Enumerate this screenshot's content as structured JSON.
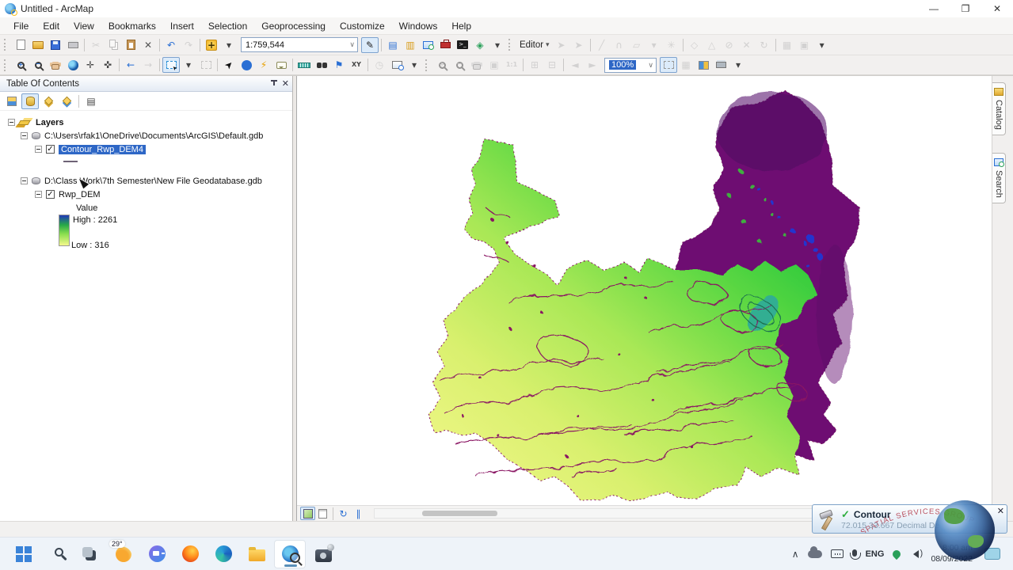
{
  "window": {
    "title": "Untitled - ArcMap",
    "minimize": "—",
    "restore": "❐",
    "close": "✕"
  },
  "menu": {
    "items": [
      "File",
      "Edit",
      "View",
      "Bookmarks",
      "Insert",
      "Selection",
      "Geoprocessing",
      "Customize",
      "Windows",
      "Help"
    ]
  },
  "glyphs": {
    "cut": "✂",
    "delete": "✕",
    "undo": "↶",
    "redo": "↷",
    "dd": "▾",
    "edit": "✎",
    "wtoc": "▤",
    "wcat": "▥",
    "model": "◈",
    "earrow": "➤",
    "eline": "╱",
    "earc": "∩",
    "epoly": "▱",
    "epoint": "✳",
    "evert": "◇",
    "ereshape": "△",
    "esplit": "⊘",
    "erotate": "↻",
    "eattr": "▦",
    "esketch": "▣",
    "fzi": "✛",
    "fzo": "✜",
    "back": "←",
    "fwd": "→",
    "selel": "➤",
    "bolt": "⚡",
    "flag": "⚑",
    "xy": "XY",
    "clock": "◷",
    "pgzi": "⊞",
    "pgzo": "⊟",
    "pg11": "1:1",
    "pgfull": "▣",
    "pggrid": "▦",
    "pgcrop": "◱",
    "pgl": "◄",
    "pgr": "►",
    "adddata": "+",
    "python": "&gt;_",
    "opt": "▤",
    "refresh": "↻",
    "pause": "∥"
  },
  "toolbar_main": {
    "scale_value": "1:759,544",
    "items": [
      {
        "n": "new-document-button",
        "g": "page"
      },
      {
        "n": "open-button",
        "g": "foldero"
      },
      {
        "n": "save-button",
        "g": "save"
      },
      {
        "n": "print-button",
        "g": "print"
      },
      {
        "sep": true
      },
      {
        "n": "cut-button",
        "g": "cut",
        "d": 1
      },
      {
        "n": "copy-button",
        "g": "copy",
        "d": 1
      },
      {
        "n": "paste-button",
        "g": "paste"
      },
      {
        "n": "delete-button",
        "g": "delete",
        "c": "#555"
      },
      {
        "sep": true
      },
      {
        "n": "undo-button",
        "g": "undo",
        "c": "#2a6fd4"
      },
      {
        "n": "redo-button",
        "g": "redo",
        "d": 1
      },
      {
        "sep": true
      },
      {
        "n": "add-data-button",
        "g": "adddata"
      },
      {
        "n": "add-data-dropdown",
        "g": "dd",
        "c": "#444"
      }
    ],
    "items2": [
      {
        "n": "edit-vertices-button",
        "g": "edit",
        "x": 1,
        "c": "#222"
      },
      {
        "sep": true
      },
      {
        "n": "table-of-contents-window-button",
        "g": "wtoc",
        "c": "#2a6fd4"
      },
      {
        "n": "catalog-window-button",
        "g": "wcat",
        "c": "#d89b18"
      },
      {
        "n": "search-window-button",
        "g": "wsearch"
      },
      {
        "n": "arctoolbox-window-button",
        "g": "toolbox"
      },
      {
        "n": "python-window-button",
        "g": "python"
      },
      {
        "n": "modelbuilder-button",
        "g": "model",
        "c": "#2aa05a"
      },
      {
        "n": "standard-toolbar-overflow",
        "g": "dd",
        "c": "#444"
      }
    ]
  },
  "toolbar_editor": {
    "label": "Editor",
    "items": [
      {
        "n": "editor-edit-tool",
        "g": "earrow",
        "d": 1
      },
      {
        "n": "editor-annotation-tool",
        "g": "earrow",
        "d": 1
      },
      {
        "sep": true
      },
      {
        "n": "straight-segment-tool",
        "g": "eline",
        "d": 1
      },
      {
        "n": "endpoint-arc-tool",
        "g": "earc",
        "d": 1
      },
      {
        "n": "construction-tool",
        "g": "epoly",
        "d": 1
      },
      {
        "n": "construction-dropdown",
        "g": "dd",
        "d": 1
      },
      {
        "n": "point-tool",
        "g": "epoint",
        "d": 1
      },
      {
        "sep": true
      },
      {
        "n": "edit-vertices-tool",
        "g": "evert",
        "d": 1
      },
      {
        "n": "reshape-feature-tool",
        "g": "ereshape",
        "d": 1
      },
      {
        "n": "cut-polygons-tool",
        "g": "esplit",
        "d": 1
      },
      {
        "n": "split-tool",
        "g": "delete",
        "d": 1
      },
      {
        "n": "rotate-tool",
        "g": "erotate",
        "d": 1
      },
      {
        "sep": true
      },
      {
        "n": "attributes-button",
        "g": "eattr",
        "d": 1
      },
      {
        "n": "sketch-properties-button",
        "g": "esketch",
        "d": 1
      },
      {
        "n": "editor-toolbar-overflow",
        "g": "dd",
        "c": "#444"
      }
    ]
  },
  "toolbar_tools": {
    "items": [
      {
        "n": "zoom-in-button",
        "g": "magp"
      },
      {
        "n": "zoom-out-button",
        "g": "magm"
      },
      {
        "n": "pan-button",
        "g": "hand"
      },
      {
        "n": "full-extent-button",
        "g": "globe"
      },
      {
        "n": "fixed-zoom-in-button",
        "g": "fzi",
        "c": "#444"
      },
      {
        "n": "fixed-zoom-out-button",
        "g": "fzo",
        "c": "#444"
      },
      {
        "sep": true
      },
      {
        "n": "go-back-extent-button",
        "g": "back",
        "c": "#2a6fd4"
      },
      {
        "n": "go-forward-extent-button",
        "g": "fwd",
        "d": 1
      },
      {
        "sep": true
      },
      {
        "n": "select-features-button",
        "g": "selfeat",
        "x": 1
      },
      {
        "n": "select-features-dropdown",
        "g": "dd",
        "c": "#444"
      },
      {
        "n": "clear-selected-features-button",
        "g": "clearsel",
        "d": 1
      },
      {
        "sep": true
      },
      {
        "n": "select-elements-button",
        "g": "selel",
        "c": "#111",
        "rot": 1
      },
      {
        "n": "identify-button",
        "g": "ident"
      },
      {
        "n": "hyperlink-button",
        "g": "bolt",
        "c": "#e8a000"
      },
      {
        "n": "html-popup-button",
        "g": "bubble"
      },
      {
        "sep": true
      },
      {
        "n": "measure-button",
        "g": "ruler"
      },
      {
        "n": "find-button",
        "g": "binoc"
      },
      {
        "n": "find-route-button",
        "g": "flag",
        "c": "#2a6fd4"
      },
      {
        "n": "go-to-xy-button",
        "g": "xy",
        "c": "#444"
      },
      {
        "sep": true
      },
      {
        "n": "time-slider-button",
        "g": "clock",
        "d": 1
      },
      {
        "n": "create-viewer-window-button",
        "g": "viewer"
      },
      {
        "n": "tools-toolbar-overflow",
        "g": "dd",
        "c": "#444"
      }
    ]
  },
  "toolbar_layout": {
    "zoom_value": "100%",
    "items": [
      {
        "n": "zoom-in-layout-button",
        "g": "magp",
        "d": 1
      },
      {
        "n": "zoom-out-layout-button",
        "g": "magm",
        "d": 1
      },
      {
        "n": "pan-layout-button",
        "g": "hand",
        "d": 1
      },
      {
        "n": "zoom-whole-page-button",
        "g": "pgfull",
        "d": 1
      },
      {
        "n": "zoom-100-button",
        "g": "pg11",
        "d": 1
      },
      {
        "sep": true
      },
      {
        "n": "fixed-zoom-in-layout-button",
        "g": "pgzi",
        "d": 1
      },
      {
        "n": "fixed-zoom-out-layout-button",
        "g": "pgzo",
        "d": 1
      },
      {
        "sep": true
      },
      {
        "n": "previous-page-button",
        "g": "pgl",
        "d": 1
      },
      {
        "n": "next-page-button",
        "g": "pgr",
        "d": 1
      }
    ],
    "items2": [
      {
        "n": "toggle-draft-mode-button",
        "g": "clearsel",
        "x": 1
      },
      {
        "n": "focus-data-frame-button",
        "g": "pggrid",
        "d": 1
      },
      {
        "n": "data-driven-pages-button",
        "g": "ddp"
      },
      {
        "n": "data-driven-page-text-button",
        "g": "ddprint"
      },
      {
        "n": "layout-toolbar-overflow",
        "g": "dd",
        "c": "#444"
      }
    ]
  },
  "toc": {
    "title": "Table Of Contents",
    "buttons": [
      {
        "n": "list-by-drawing-order-button",
        "g": "lod"
      },
      {
        "n": "list-by-source-button",
        "g": "los",
        "x": 1
      },
      {
        "n": "list-by-visibility-button",
        "g": "lov"
      },
      {
        "n": "list-by-selection-button",
        "g": "losel"
      },
      {
        "sep": true
      },
      {
        "n": "toc-options-button",
        "g": "opt",
        "c": "#444"
      }
    ],
    "layers_root": "Layers",
    "gdb1": "C:\\Users\\rfak1\\OneDrive\\Documents\\ArcGIS\\Default.gdb",
    "layer1": "Contour_Rwp_DEM4",
    "gdb2": "D:\\Class Work\\7th Semester\\New File Geodatabase.gdb",
    "layer2": "Rwp_DEM",
    "legend": {
      "field": "Value",
      "high": "High : 2261",
      "low": "Low : 316"
    },
    "checkmark": "✓"
  },
  "dock": {
    "tabs": [
      "Catalog",
      "Search"
    ]
  },
  "view_controls": {
    "items": [
      {
        "n": "data-view-button",
        "g": "dv",
        "x": 1
      },
      {
        "n": "layout-view-button",
        "g": "lv"
      },
      {
        "sep": true
      },
      {
        "n": "refresh-view-button",
        "g": "refresh",
        "c": "#2a6fd4"
      },
      {
        "n": "pause-drawing-button",
        "g": "pause",
        "c": "#2a6fd4"
      }
    ]
  },
  "map": {
    "legend_colors": {
      "high": "#2038b8",
      "mid": "#28a848",
      "low": "#f4f88c"
    },
    "contour_color": "#8a1563",
    "purple_region_color": "#6e0d72",
    "water_speckle_color": "#2335cf"
  },
  "toast": {
    "title": "Contour",
    "check": "✓",
    "close": "✕",
    "status_text": "72.015 33.667 Decimal De",
    "watermark": "SPATIAL SERVICES GROUP"
  },
  "taskbar": {
    "items": [
      {
        "n": "taskbar-start",
        "g": "tstart"
      },
      {
        "n": "taskbar-search",
        "g": "tsearch"
      },
      {
        "n": "taskbar-task-view",
        "g": "ttask"
      },
      {
        "n": "taskbar-weather",
        "g": "tweather",
        "t": "29°"
      },
      {
        "n": "taskbar-chat",
        "g": "tchat"
      },
      {
        "n": "taskbar-firefox",
        "g": "tfirefox"
      },
      {
        "n": "taskbar-edge",
        "g": "tedge"
      },
      {
        "n": "taskbar-file-explorer",
        "g": "tfolder"
      },
      {
        "n": "taskbar-arcmap",
        "g": "tarcmap",
        "x": 1
      },
      {
        "n": "taskbar-screen-recorder",
        "g": "trecorder"
      }
    ],
    "language": "ENG",
    "time": "8:00 am",
    "date": "08/09/2022",
    "chevron": "∧"
  }
}
